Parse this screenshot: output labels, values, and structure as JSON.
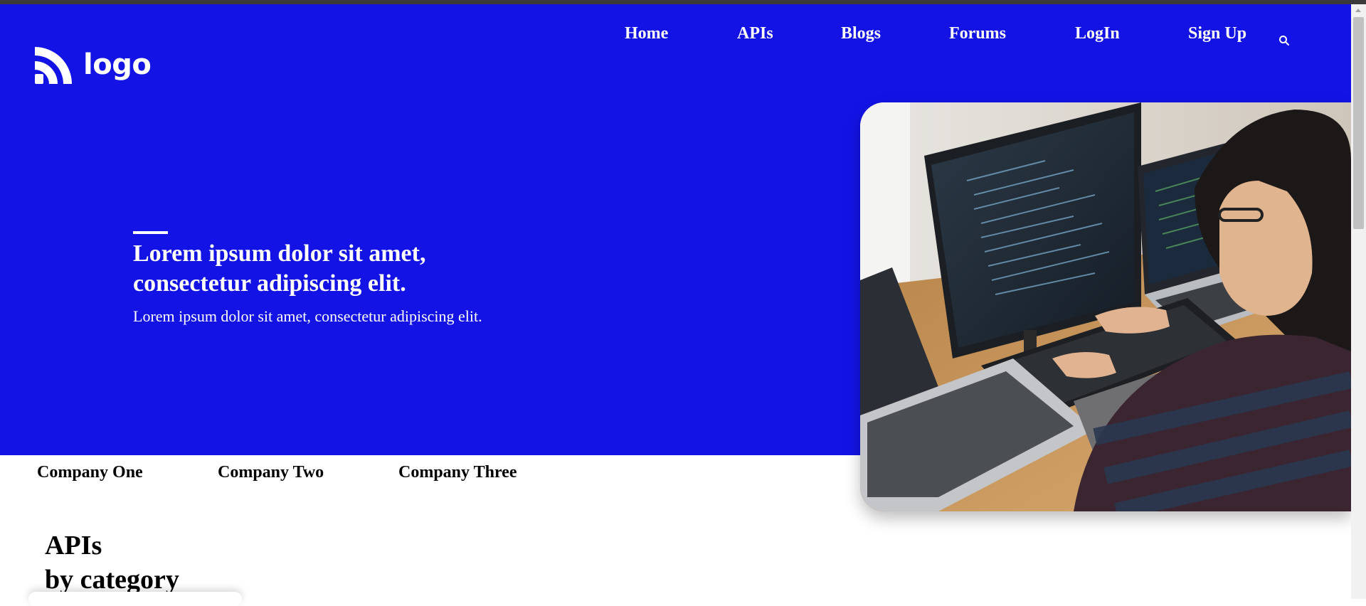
{
  "brand": {
    "logo_text": "logo"
  },
  "nav": {
    "items": [
      {
        "label": "Home"
      },
      {
        "label": "APIs"
      },
      {
        "label": "Blogs"
      },
      {
        "label": "Forums"
      },
      {
        "label": "LogIn"
      },
      {
        "label": "Sign Up"
      }
    ],
    "search_icon": "search-icon"
  },
  "hero": {
    "title": "Lorem ipsum dolor sit amet, consectetur adipiscing elit.",
    "subtitle": "Lorem ipsum dolor sit amet, consectetur adipiscing elit.",
    "image_subject": "developer coding at computer with multiple monitors"
  },
  "companies": [
    {
      "label": "Company One"
    },
    {
      "label": "Company Two"
    },
    {
      "label": "Company Three"
    }
  ],
  "section": {
    "title_line1": "APIs",
    "title_line2": "by category"
  },
  "colors": {
    "hero_bg": "#1313e6",
    "text_on_hero": "#ffffff"
  }
}
